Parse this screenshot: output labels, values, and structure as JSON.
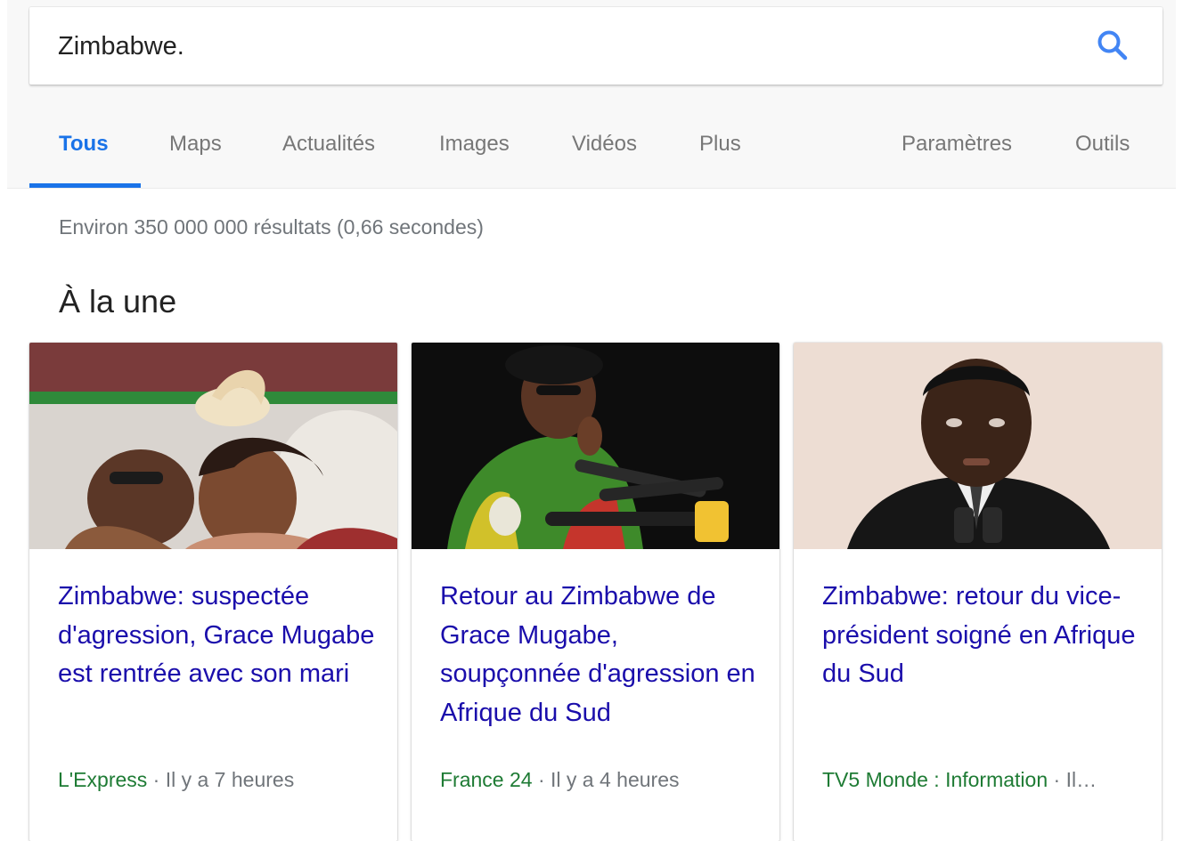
{
  "search": {
    "query": "Zimbabwe.",
    "search_icon": "search-icon"
  },
  "tabs": [
    {
      "label": "Tous",
      "active": true
    },
    {
      "label": "Maps"
    },
    {
      "label": "Actualités"
    },
    {
      "label": "Images"
    },
    {
      "label": "Vidéos"
    },
    {
      "label": "Plus"
    },
    {
      "label": "Paramètres"
    },
    {
      "label": "Outils"
    }
  ],
  "stats": "Environ 350 000 000 résultats (0,66 secondes)",
  "top_stories": {
    "heading": "À la une",
    "cards": [
      {
        "title": "Zimbabwe: suspectée d'agression, Grace Mugabe est rentrée avec son mari",
        "source": "L'Express",
        "time": "Il y a 7 heures"
      },
      {
        "title": "Retour au Zimbabwe de Grace Mugabe, soupçonnée d'agression en Afrique du Sud",
        "source": "France 24",
        "time": "Il y a 4 heures"
      },
      {
        "title": "Zimbabwe: retour du vice-président soigné en Afrique du Sud",
        "source": "TV5 Monde : Information",
        "time": "Il…"
      }
    ]
  },
  "colors": {
    "accent": "#1a73e8",
    "link": "#1a0dab",
    "source": "#1e7b34",
    "muted": "#70757a"
  }
}
